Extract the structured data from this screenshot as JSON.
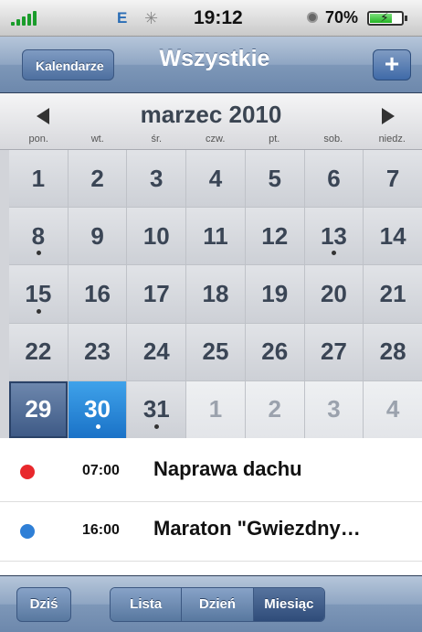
{
  "status_bar": {
    "carrier": "E",
    "time": "19:12",
    "battery_percent": "70%",
    "battery_level": 0.7,
    "icons": [
      "signal-icon",
      "activity-spinner-icon",
      "alarm-clock-icon",
      "battery-charging-icon"
    ]
  },
  "nav": {
    "back_label": "Kalendarze",
    "title": "Wszystkie",
    "add_label": "+"
  },
  "calendar": {
    "month_title": "marzec 2010",
    "weekdays": [
      "pon.",
      "wt.",
      "śr.",
      "czw.",
      "pt.",
      "sob.",
      "niedz."
    ],
    "weeks": [
      [
        {
          "d": "1"
        },
        {
          "d": "2"
        },
        {
          "d": "3"
        },
        {
          "d": "4"
        },
        {
          "d": "5"
        },
        {
          "d": "6"
        },
        {
          "d": "7"
        }
      ],
      [
        {
          "d": "8",
          "dot": true
        },
        {
          "d": "9"
        },
        {
          "d": "10"
        },
        {
          "d": "11"
        },
        {
          "d": "12"
        },
        {
          "d": "13",
          "dot": true
        },
        {
          "d": "14"
        }
      ],
      [
        {
          "d": "15",
          "dot": true
        },
        {
          "d": "16"
        },
        {
          "d": "17"
        },
        {
          "d": "18"
        },
        {
          "d": "19"
        },
        {
          "d": "20"
        },
        {
          "d": "21"
        }
      ],
      [
        {
          "d": "22"
        },
        {
          "d": "23"
        },
        {
          "d": "24"
        },
        {
          "d": "25"
        },
        {
          "d": "26"
        },
        {
          "d": "27"
        },
        {
          "d": "28"
        }
      ],
      [
        {
          "d": "29",
          "state": "selected"
        },
        {
          "d": "30",
          "state": "today",
          "dot": true
        },
        {
          "d": "31",
          "dot": true
        },
        {
          "d": "1",
          "state": "other"
        },
        {
          "d": "2",
          "state": "other"
        },
        {
          "d": "3",
          "state": "other"
        },
        {
          "d": "4",
          "state": "other"
        }
      ]
    ]
  },
  "events": [
    {
      "time": "07:00",
      "title": "Naprawa dachu",
      "color": "#e8282c"
    },
    {
      "time": "16:00",
      "title": "Maraton \"Gwiezdny…",
      "color": "#2f7fd6"
    }
  ],
  "toolbar": {
    "today_label": "Dziś",
    "segments": [
      {
        "label": "Lista"
      },
      {
        "label": "Dzień"
      },
      {
        "label": "Miesiąc",
        "active": true
      }
    ]
  },
  "colors": {
    "accent": "#1a72c7",
    "selected": "#3e5a86"
  }
}
